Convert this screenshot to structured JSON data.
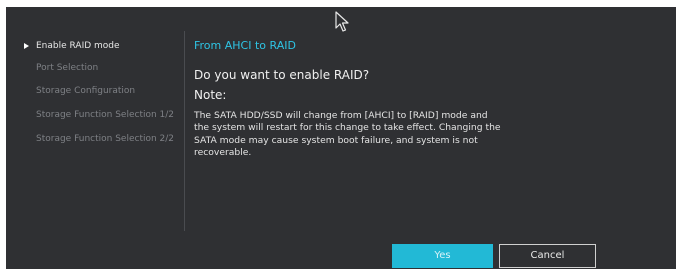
{
  "sidebar": {
    "items": [
      {
        "label": "Enable RAID mode",
        "active": true
      },
      {
        "label": "Port Selection",
        "active": false
      },
      {
        "label": "Storage Configuration",
        "active": false
      },
      {
        "label": "Storage Function Selection 1/2",
        "active": false
      },
      {
        "label": "Storage Function Selection 2/2",
        "active": false
      }
    ]
  },
  "dialog": {
    "subtitle": "From AHCI to RAID",
    "question": "Do you want to enable RAID?",
    "note_label": "Note:",
    "body_lines": [
      "The SATA HDD/SSD will change from [AHCI] to [RAID] mode and",
      "the system will restart for this change to take effect. Changing the",
      "SATA mode may cause system boot failure, and system is not",
      "recoverable."
    ],
    "yes_label": "Yes",
    "cancel_label": "Cancel"
  },
  "colors": {
    "background": "#2f3033",
    "accent": "#2ec4e4",
    "yes_button": "#22b9d6",
    "inactive_text": "#7e8085"
  },
  "icons": {
    "cursor": "mouse-pointer-icon",
    "active_marker": "triangle-right-icon"
  }
}
